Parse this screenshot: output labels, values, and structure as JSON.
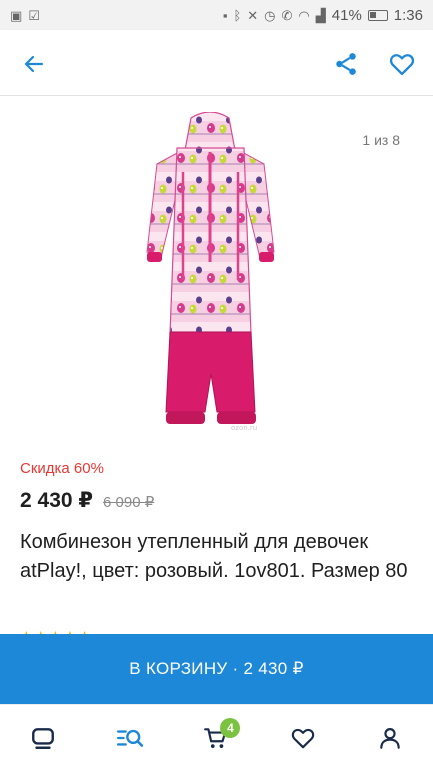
{
  "status_bar": {
    "battery": "41%",
    "time": "1:36"
  },
  "app_bar": {
    "back_icon": "arrow-left-icon",
    "share_icon": "share-icon",
    "favorite_icon": "heart-outline-icon",
    "accent_color": "#1e88d8"
  },
  "gallery": {
    "counter": "1 из 8",
    "watermark": "ozon.ru"
  },
  "product": {
    "discount": "Скидка 60%",
    "price": "2 430 ₽",
    "old_price": "6 090 ₽",
    "title": "Комбинезон утепленный для девочек atPlay!, цвет: розовый. 1ov801. Размер 80",
    "discount_color": "#e53935"
  },
  "cart_button": {
    "label": "В КОРЗИНУ · 2 430 ₽",
    "color": "#1e88d8"
  },
  "bottom_nav": {
    "items": [
      {
        "icon": "home-icon"
      },
      {
        "icon": "catalog-search-icon"
      },
      {
        "icon": "cart-icon",
        "badge": "4"
      },
      {
        "icon": "heart-icon"
      },
      {
        "icon": "profile-icon"
      }
    ],
    "badge_color": "#7cc241"
  }
}
